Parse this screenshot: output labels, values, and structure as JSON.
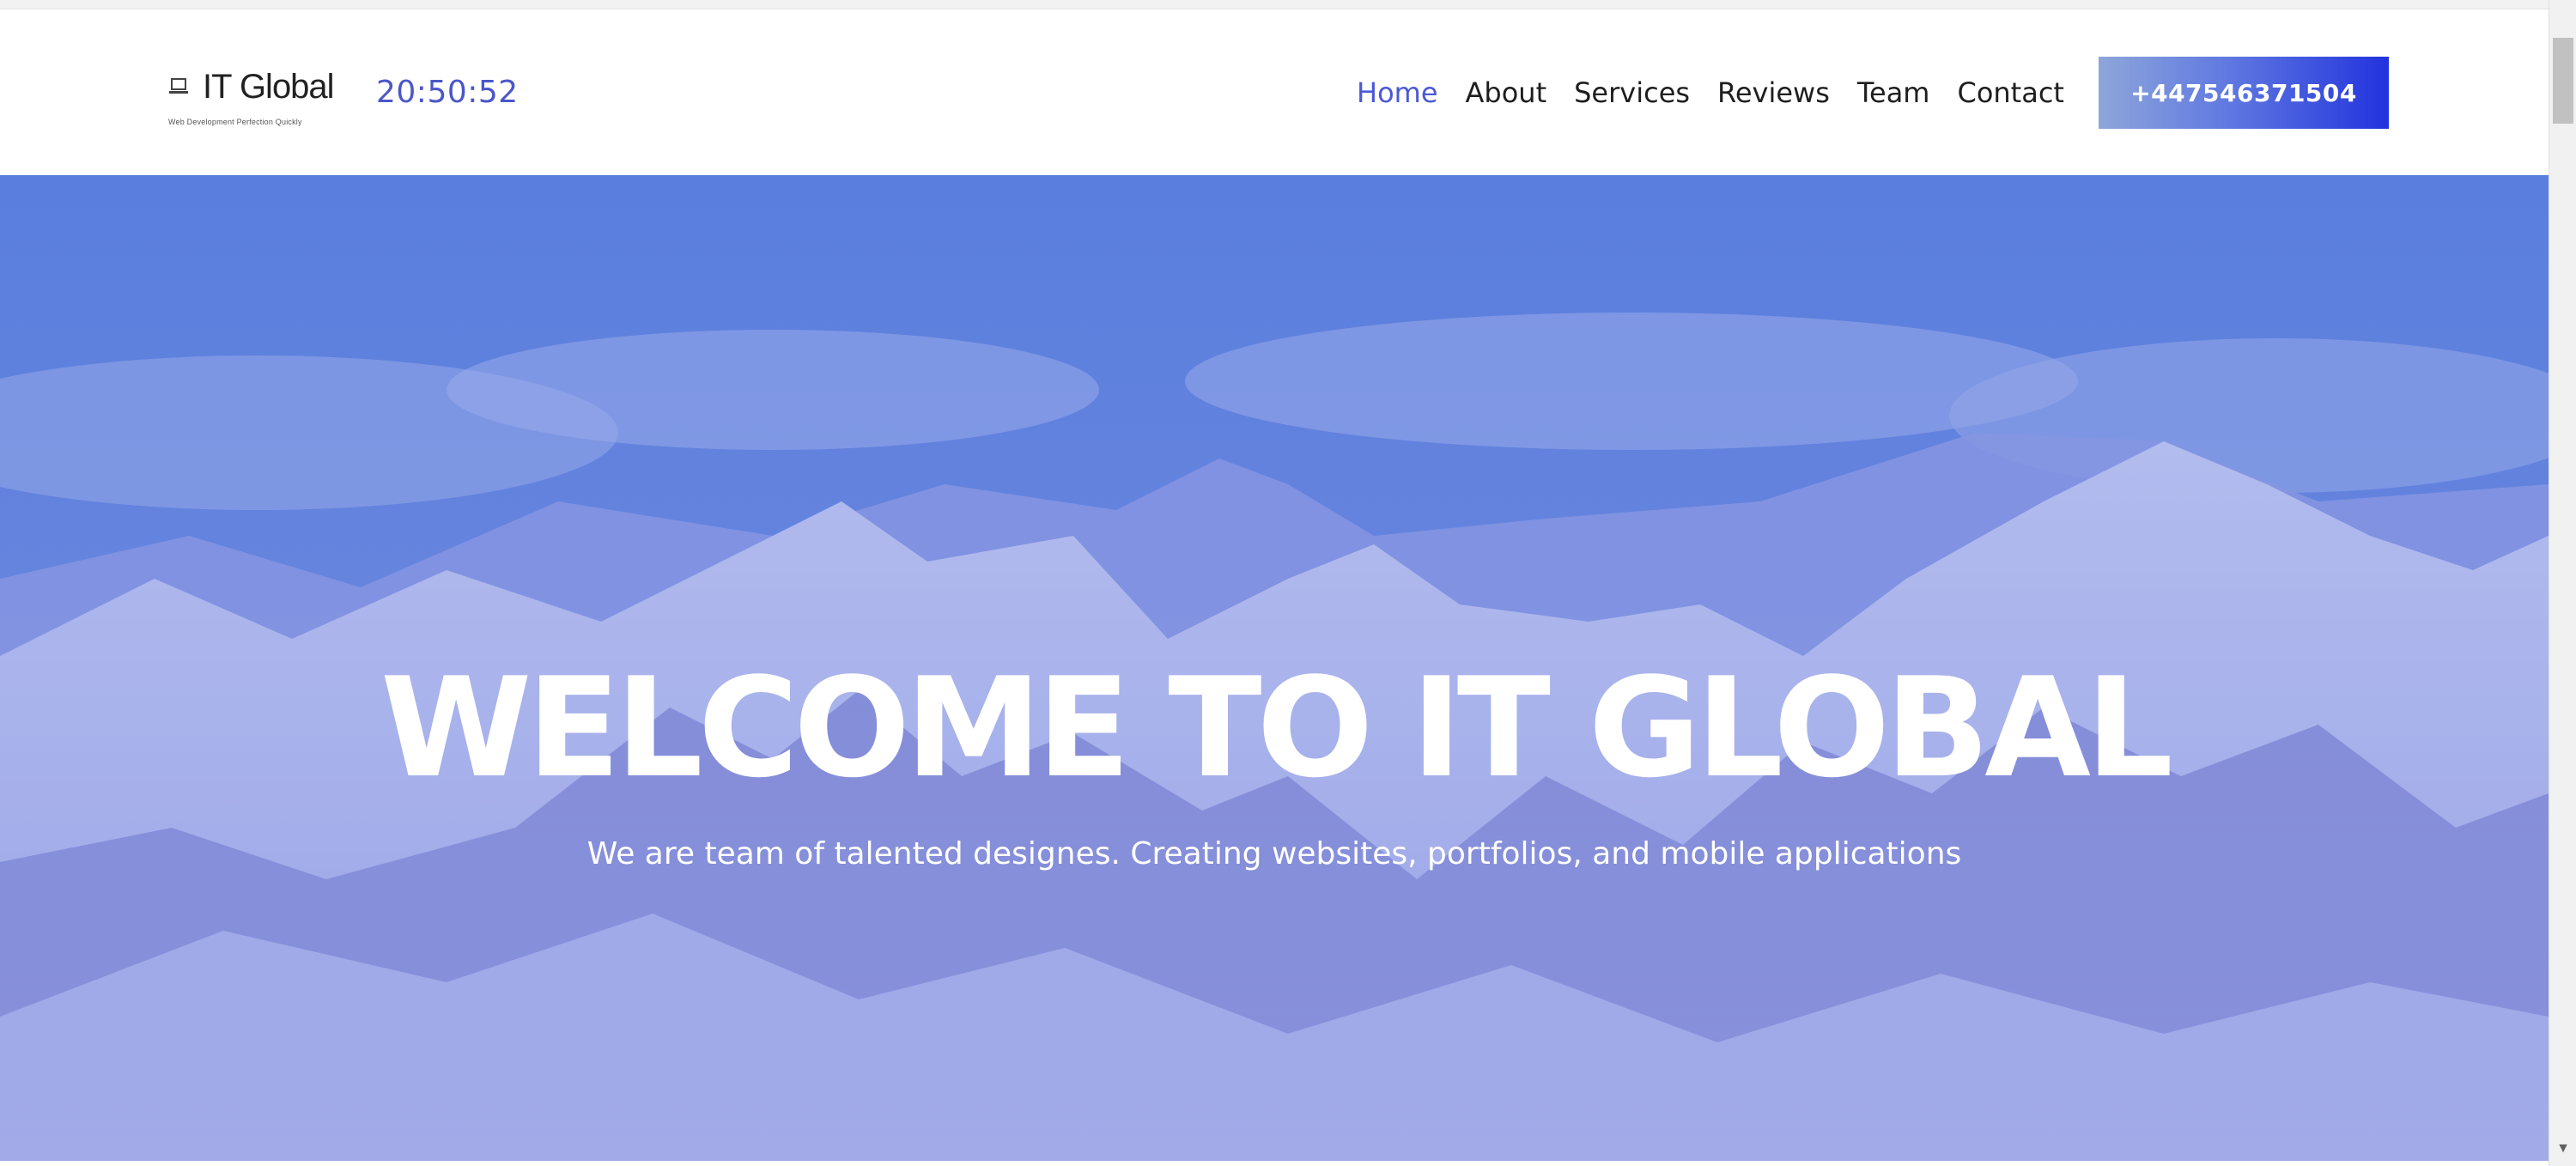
{
  "header": {
    "logo": {
      "name": "IT Global",
      "tagline": "Web Development Perfection Quickly"
    },
    "clock": "20:50:52",
    "nav": [
      {
        "label": "Home",
        "active": true
      },
      {
        "label": "About",
        "active": false
      },
      {
        "label": "Services",
        "active": false
      },
      {
        "label": "Reviews",
        "active": false
      },
      {
        "label": "Team",
        "active": false
      },
      {
        "label": "Contact",
        "active": false
      }
    ],
    "phone_button": "+447546371504"
  },
  "hero": {
    "title": "WELCOME TO IT GLOBAL",
    "subtitle": "We are team of talented designes. Creating websites, portfolios, and mobile applications"
  },
  "icons": {
    "logo": "laptop-icon",
    "scroll_down": "chevron-down-icon"
  },
  "colors": {
    "accent": "#4b58d6",
    "button_gradient_end": "#2233dd",
    "hero_overlay": "#5b6fdc"
  }
}
